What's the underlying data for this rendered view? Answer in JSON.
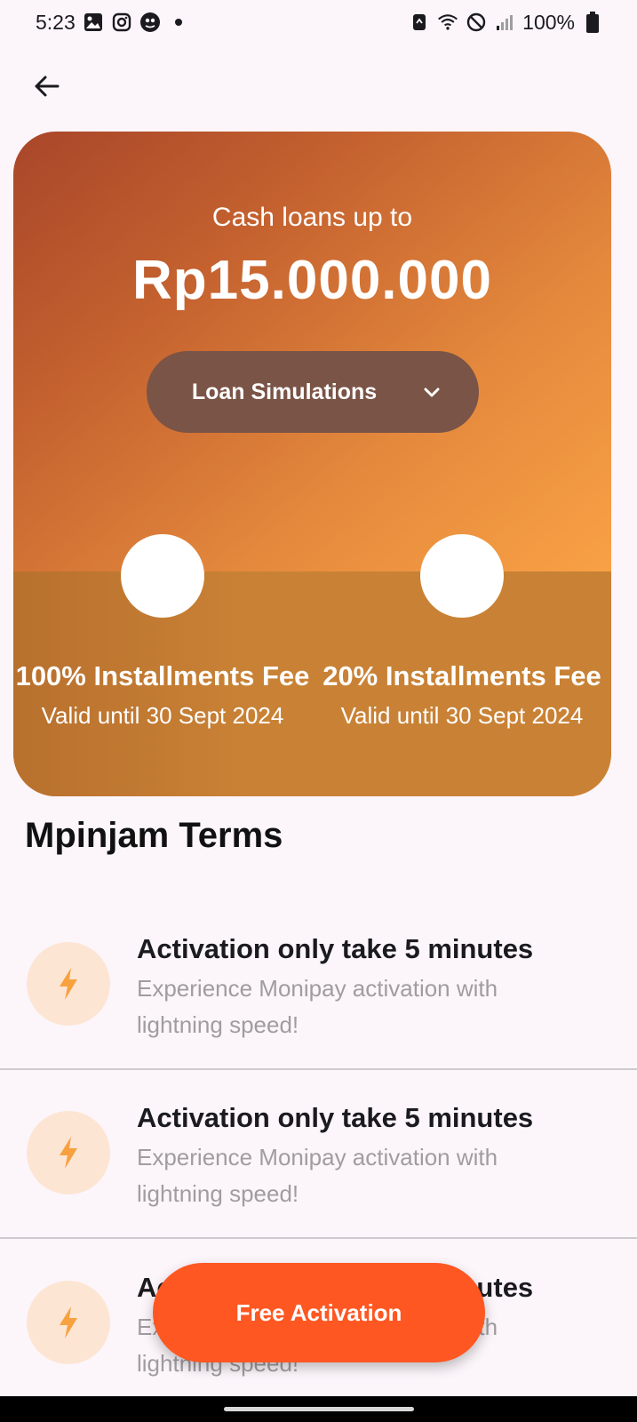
{
  "status_bar": {
    "time": "5:23",
    "battery": "100%",
    "left_icons": [
      "gallery-icon",
      "instagram-icon",
      "app-icon",
      "dot-icon"
    ],
    "right_icons": [
      "sync-icon",
      "wifi-icon",
      "do-not-disturb-icon",
      "signal-icon",
      "battery-icon"
    ]
  },
  "hero": {
    "subtitle": "Cash loans up to",
    "amount": "Rp15.000.000",
    "simulation_button": "Loan Simulations",
    "promos": [
      {
        "title": "100% Installments Fee",
        "valid": "Valid until 30 Sept 2024"
      },
      {
        "title": "20% Installments Fee",
        "valid": "Valid until 30 Sept 2024"
      }
    ],
    "colors": {
      "gradient_start": "#a8462a",
      "gradient_end": "#f9a146",
      "button_bg": "#7a5446"
    }
  },
  "terms": {
    "heading": "Mpinjam Terms",
    "items": [
      {
        "icon": "lightning-icon",
        "title": "Activation only take 5 minutes",
        "description": "Experience Monipay activation with lightning speed!"
      },
      {
        "icon": "lightning-icon",
        "title": "Activation only take 5 minutes",
        "description": "Experience Monipay activation with lightning speed!"
      },
      {
        "icon": "lightning-icon",
        "title": "Activation only take 5 minutes",
        "description": "Experience Monipay activation with lightning speed!"
      }
    ]
  },
  "cta": {
    "label": "Free Activation",
    "color": "#fe5722"
  },
  "accent_color": "#f7a13f"
}
